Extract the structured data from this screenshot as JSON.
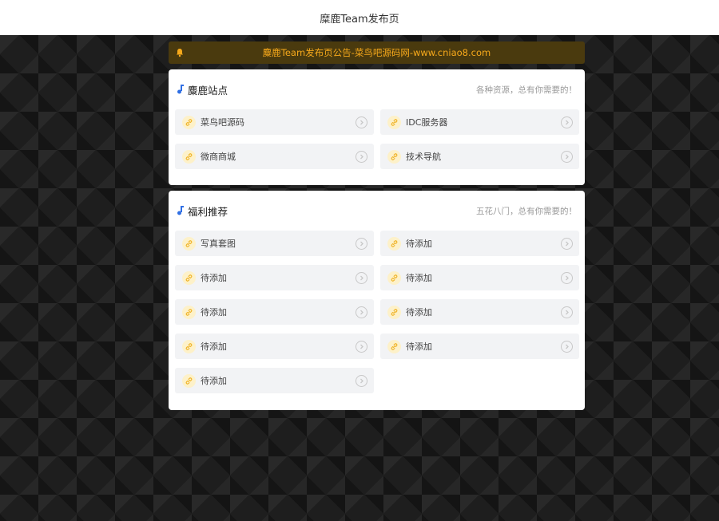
{
  "header": {
    "title": "糜鹿Team发布页"
  },
  "notice": {
    "text": "麋鹿Team发布页公告-菜鸟吧源码网-www.cniao8.com",
    "color": "#f7a91b"
  },
  "sections": [
    {
      "title": "麋鹿站点",
      "subtitle": "各种资源，总有你需要的！",
      "items": [
        {
          "label": "菜鸟吧源码"
        },
        {
          "label": "IDC服务器"
        },
        {
          "label": "微商商城"
        },
        {
          "label": "技术导航"
        }
      ]
    },
    {
      "title": "福利推荐",
      "subtitle": "五花八门，总有你需要的！",
      "items": [
        {
          "label": "写真套图"
        },
        {
          "label": "待添加"
        },
        {
          "label": "待添加"
        },
        {
          "label": "待添加"
        },
        {
          "label": "待添加"
        },
        {
          "label": "待添加"
        },
        {
          "label": "待添加"
        },
        {
          "label": "待添加"
        },
        {
          "label": "待添加"
        }
      ]
    }
  ],
  "icons": {
    "notice": "bell-icon",
    "section": "music-note-icon",
    "item": "link-icon",
    "item_arrow": "chevron-right-circle-icon"
  },
  "colors": {
    "accent": "#3b82f6",
    "link_icon": "#f0b429"
  }
}
